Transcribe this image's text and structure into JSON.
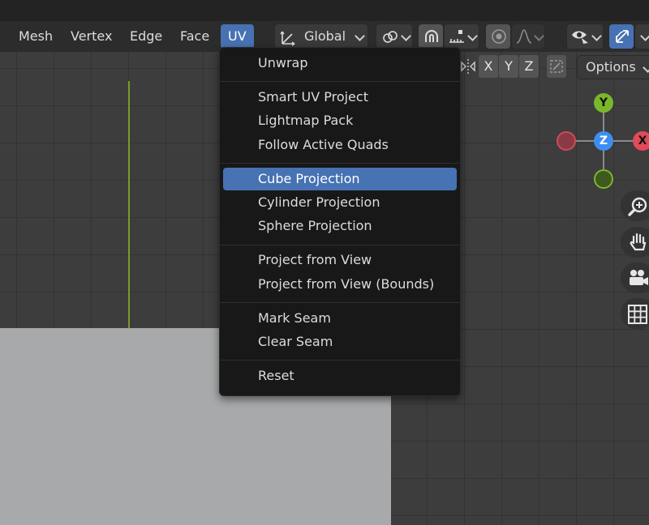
{
  "header": {
    "menus": [
      "Mesh",
      "Vertex",
      "Edge",
      "Face",
      "UV"
    ],
    "active_menu": "UV",
    "transform_orientation": "Global",
    "icons": [
      "transform-orientation-icon",
      "link-icon",
      "snap-icon",
      "snap-increment-icon",
      "proportional-edit-icon",
      "falloff-curve-icon",
      "visibility-icon",
      "gizmo-icon"
    ]
  },
  "subtoolbar": {
    "axes": [
      "X",
      "Y",
      "Z"
    ],
    "options_label": "Options"
  },
  "gizmo": {
    "labels": {
      "y": "Y",
      "z": "Z",
      "x": "X"
    },
    "colors": {
      "x": "#e04a5a",
      "y": "#7ab82b",
      "z": "#3b8ff0"
    }
  },
  "nav_buttons": [
    "zoom-icon",
    "hand-icon",
    "camera-icon",
    "grid-icon"
  ],
  "uv_menu": {
    "groups": [
      [
        "Unwrap"
      ],
      [
        "Smart UV Project",
        "Lightmap Pack",
        "Follow Active Quads"
      ],
      [
        "Cube Projection",
        "Cylinder Projection",
        "Sphere Projection"
      ],
      [
        "Project from View",
        "Project from View (Bounds)"
      ],
      [
        "Mark Seam",
        "Clear Seam"
      ],
      [
        "Reset"
      ]
    ],
    "highlighted": "Cube Projection"
  },
  "colors": {
    "accent": "#4772b3",
    "menu_bg": "#181818",
    "viewport_bg": "#3d3d3d",
    "plane": "#a8a9aa"
  }
}
